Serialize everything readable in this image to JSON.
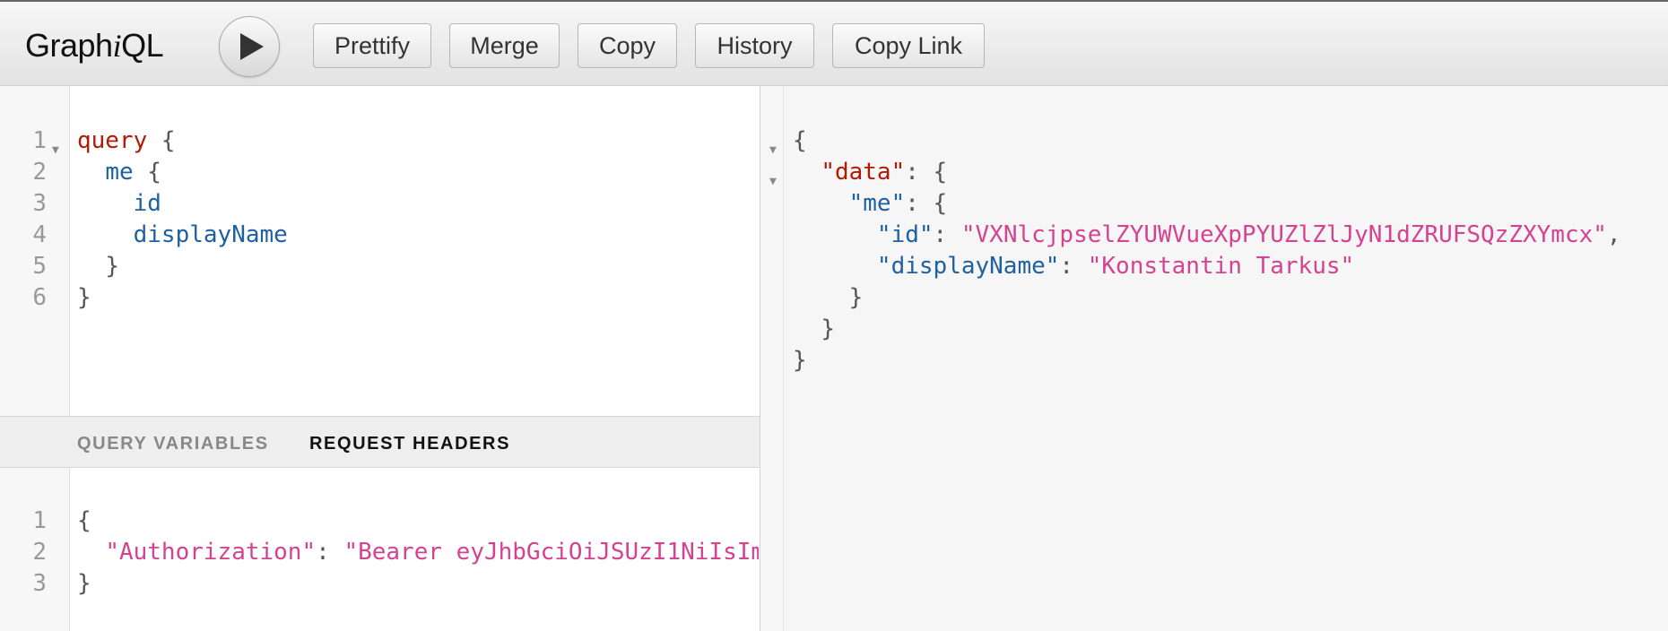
{
  "toolbar": {
    "logo_prefix": "Graph",
    "logo_italic": "i",
    "logo_suffix": "QL",
    "execute_label": "Execute Query",
    "buttons": {
      "prettify": "Prettify",
      "merge": "Merge",
      "copy": "Copy",
      "history": "History",
      "copy_link": "Copy Link"
    }
  },
  "query_editor": {
    "line_numbers": [
      "1",
      "2",
      "3",
      "4",
      "5",
      "6"
    ],
    "l1_kw": "query",
    "l1_rest": " {",
    "l2_field": "me",
    "l2_rest": " {",
    "l3_field": "id",
    "l4_field": "displayName",
    "l5": "}",
    "l6": "}"
  },
  "secondary_tabs": {
    "variables": "QUERY VARIABLES",
    "headers": "REQUEST HEADERS",
    "active": "headers"
  },
  "headers_editor": {
    "line_numbers": [
      "1",
      "2",
      "3"
    ],
    "l1": "{",
    "l2_key": "\"Authorization\"",
    "l2_sep": ": ",
    "l2_value": "\"Bearer eyJhbGciOiJSUzI1NiIsIm",
    "l3": "}"
  },
  "result": {
    "l1": "{",
    "l2_key": "\"data\"",
    "l2_rest": ": {",
    "l3_key": "\"me\"",
    "l3_rest": ": {",
    "l4_key": "\"id\"",
    "l4_sep": ": ",
    "l4_value": "\"VXNlcjpselZYUWVueXpPYUZlZlJyN1dZRUFSQzZXYmcx\"",
    "l4_end": ",",
    "l5_key": "\"displayName\"",
    "l5_sep": ": ",
    "l5_value": "\"Konstantin Tarkus\"",
    "l6": "}",
    "l7": "}",
    "l8": "}"
  },
  "colors": {
    "keyword": "#b11a04",
    "field": "#1f61a0",
    "string": "#d64292",
    "punctuation": "#555555"
  }
}
